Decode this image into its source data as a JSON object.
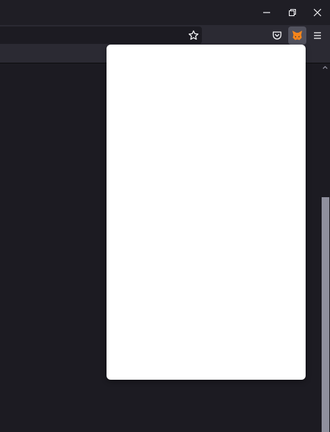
{
  "window": {
    "controls": {
      "minimize_icon": "minimize-icon",
      "restore_icon": "restore-icon",
      "close_icon": "close-icon"
    }
  },
  "toolbar": {
    "bookmark_icon": "star-icon",
    "pocket_icon": "pocket-icon",
    "extension_icon": "metamask-fox-icon",
    "menu_icon": "hamburger-menu-icon",
    "accent_color": "#f6851b"
  },
  "popup": {
    "state": "blank",
    "background": "#ffffff"
  }
}
